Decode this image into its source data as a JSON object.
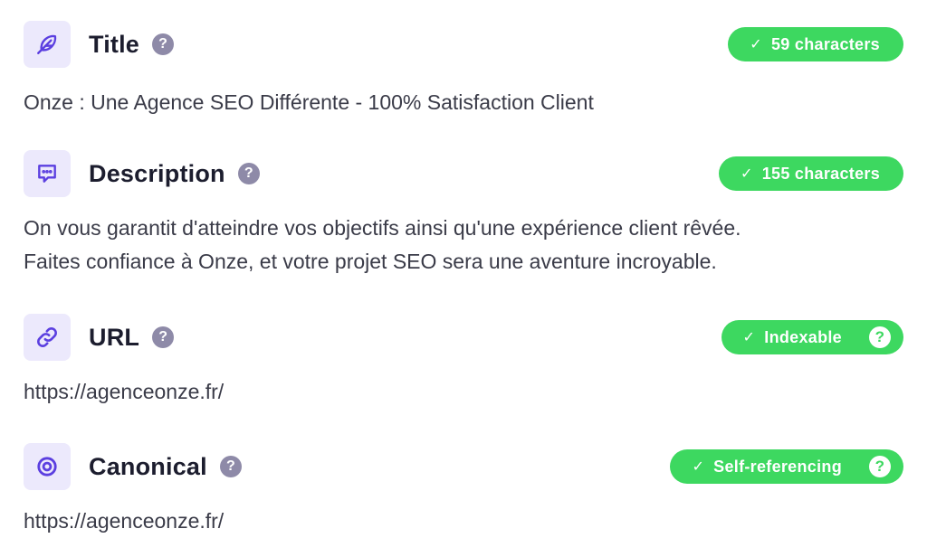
{
  "title_section": {
    "icon": "feather-icon",
    "label": "Title",
    "help": "?",
    "badge_check": "✓",
    "badge": "59 characters",
    "value": "Onze : Une Agence SEO Différente - 100% Satisfaction Client"
  },
  "description_section": {
    "icon": "message-icon",
    "label": "Description",
    "help": "?",
    "badge_check": "✓",
    "badge": "155 characters",
    "value_lines": [
      "On vous garantit d'atteindre vos objectifs ainsi qu'une expérience client rêvée.",
      "Faites confiance à Onze, et votre projet SEO sera une aventure incroyable."
    ]
  },
  "url_section": {
    "icon": "link-icon",
    "label": "URL",
    "help": "?",
    "badge_check": "✓",
    "badge": "Indexable",
    "badge_help": "?",
    "value": "https://agenceonze.fr/"
  },
  "canonical_section": {
    "icon": "target-icon",
    "label": "Canonical",
    "help": "?",
    "badge_check": "✓",
    "badge": "Self-referencing",
    "badge_help": "?",
    "value": "https://agenceonze.fr/"
  },
  "colors": {
    "accent": "#5b3fe0",
    "badge_green": "#3dd860",
    "icon_bg": "#ece9fc",
    "help_grey": "#8e8aa8"
  }
}
